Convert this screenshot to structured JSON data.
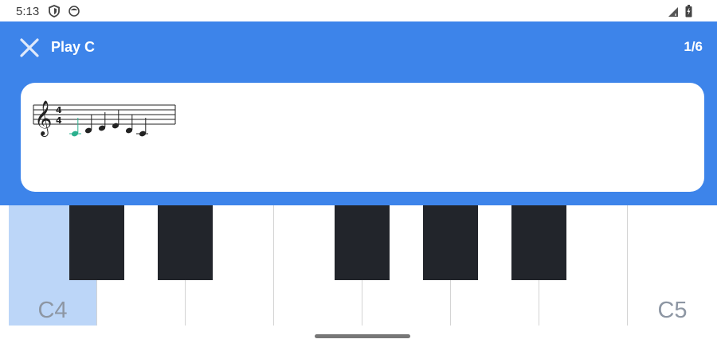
{
  "status_bar": {
    "time": "5:13",
    "icons": [
      "shield-icon",
      "face-icon",
      "signal-icon",
      "battery-icon"
    ]
  },
  "app_bar": {
    "close_icon": "close-icon",
    "title": "Play C",
    "progress": "1/6",
    "background": "#3d84ea"
  },
  "sheet": {
    "time_signature_top": "4",
    "time_signature_bottom": "4",
    "clef": "treble-clef",
    "note_count": 6,
    "highlight_color": "#2bb08e"
  },
  "piano": {
    "white_keys": [
      {
        "label": "C4",
        "active": true
      },
      {
        "label": "",
        "active": false
      },
      {
        "label": "",
        "active": false
      },
      {
        "label": "",
        "active": false
      },
      {
        "label": "",
        "active": false
      },
      {
        "label": "",
        "active": false
      },
      {
        "label": "",
        "active": false
      },
      {
        "label": "C5",
        "active": false
      }
    ],
    "black_keys": [
      "C#4",
      "D#4",
      "F#4",
      "G#4",
      "A#4"
    ],
    "active_color": "#bcd6f8"
  }
}
